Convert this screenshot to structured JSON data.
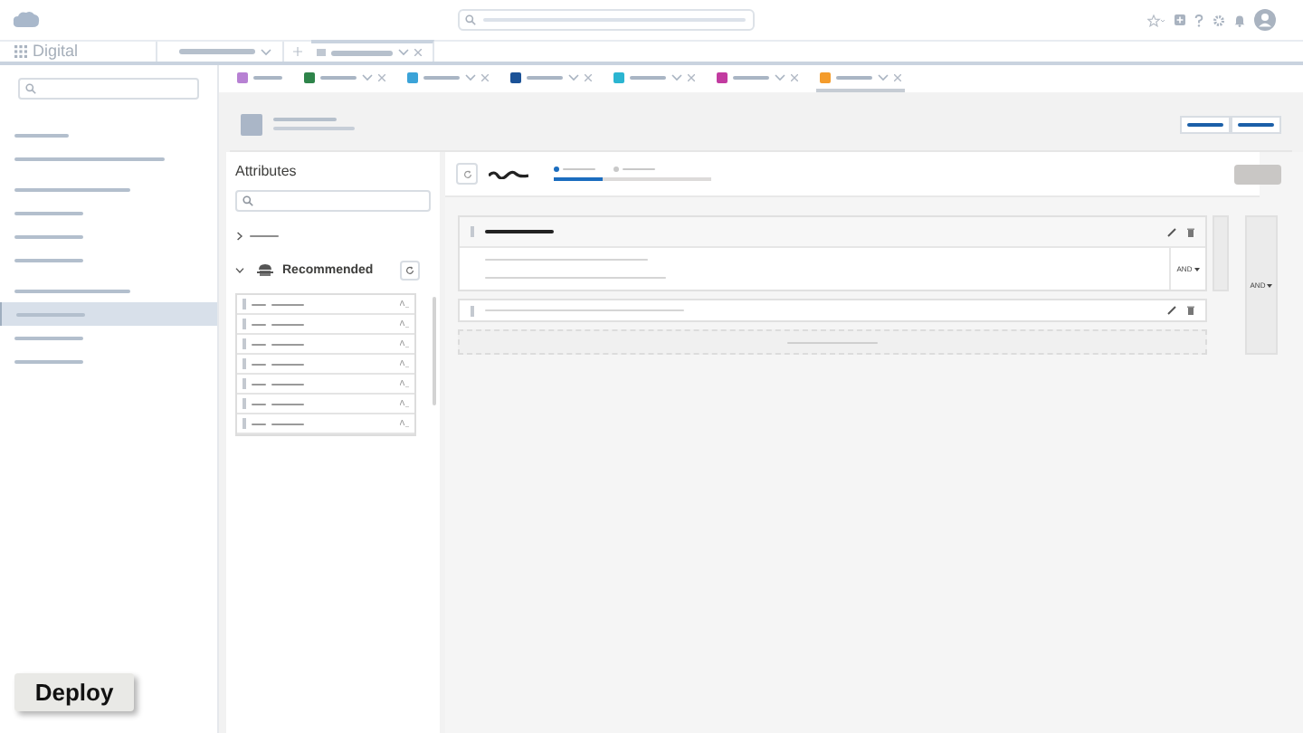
{
  "nav": {
    "app_name": "Digital"
  },
  "sidebar": {
    "items": [
      {
        "selected": false
      },
      {
        "selected": false
      },
      {
        "selected": false
      },
      {
        "selected": false
      },
      {
        "selected": false
      },
      {
        "selected": false
      },
      {
        "selected": false
      },
      {
        "selected": true
      },
      {
        "selected": false
      },
      {
        "selected": false
      }
    ]
  },
  "subtabs": [
    {
      "color": "#b781d3",
      "selected": false
    },
    {
      "color": "#2e844a",
      "selected": false
    },
    {
      "color": "#3ba3d8",
      "selected": false
    },
    {
      "color": "#1b5297",
      "selected": false
    },
    {
      "color": "#2bb5d1",
      "selected": false
    },
    {
      "color": "#c23ba0",
      "selected": false
    },
    {
      "color": "#f49c2c",
      "selected": true
    }
  ],
  "attributes": {
    "title": "Attributes",
    "groups": [
      {
        "expanded": false
      },
      {
        "label": "Recommended",
        "expanded": true,
        "rows": [
          {
            "kind": "attribute"
          },
          {
            "kind": "attribute"
          },
          {
            "kind": "attribute"
          },
          {
            "kind": "attribute"
          },
          {
            "kind": "attribute"
          },
          {
            "kind": "attribute"
          },
          {
            "kind": "attribute"
          }
        ]
      }
    ]
  },
  "progress": {
    "steps": [
      {
        "selected": true
      },
      {
        "selected": false
      }
    ],
    "level": 0.31
  },
  "rules": {
    "inner_operator": "AND",
    "outer_operator": "AND"
  },
  "deploy_button": "Deploy"
}
